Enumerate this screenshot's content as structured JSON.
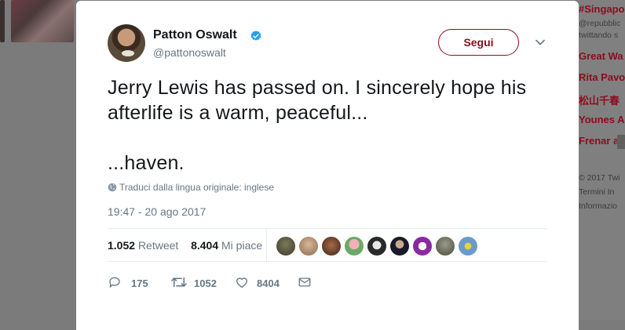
{
  "background": {
    "trends": [
      "#Singapo",
      "Great Wa",
      "Rita Pavo",
      "松山千春",
      "Younes A",
      "Frenar a l"
    ],
    "trend_sub1": "@repubblic",
    "trend_sub2": "twittando s",
    "footer": [
      "© 2017 Twi",
      "Termini   In",
      "Informazio"
    ]
  },
  "tweet": {
    "author_name": "Patton Oswalt",
    "author_handle": "@pattonoswalt",
    "follow_label": "Segui",
    "text_line1": "Jerry Lewis has passed on. I sincerely hope his afterlife is a warm, peaceful...",
    "text_line2": "...haven.",
    "translate_label": "Traduci dalla lingua originale: inglese",
    "timestamp": "19:47 - 20 ago 2017",
    "retweet_count": "1.052",
    "retweet_label": "Retweet",
    "like_count": "8.404",
    "like_label": "Mi piace",
    "likers_count": 9,
    "actions": {
      "reply_count": "175",
      "retweet_count": "1052",
      "like_count": "8404"
    }
  },
  "icons": [
    "verified-badge-icon",
    "chevron-down-icon",
    "globe-icon",
    "reply-icon",
    "retweet-icon",
    "like-icon",
    "direct-message-icon"
  ],
  "colors": {
    "accent": "#8a0d1c",
    "verified": "#1da1f2",
    "secondary_text": "#657786",
    "primary_text": "#14171a"
  }
}
